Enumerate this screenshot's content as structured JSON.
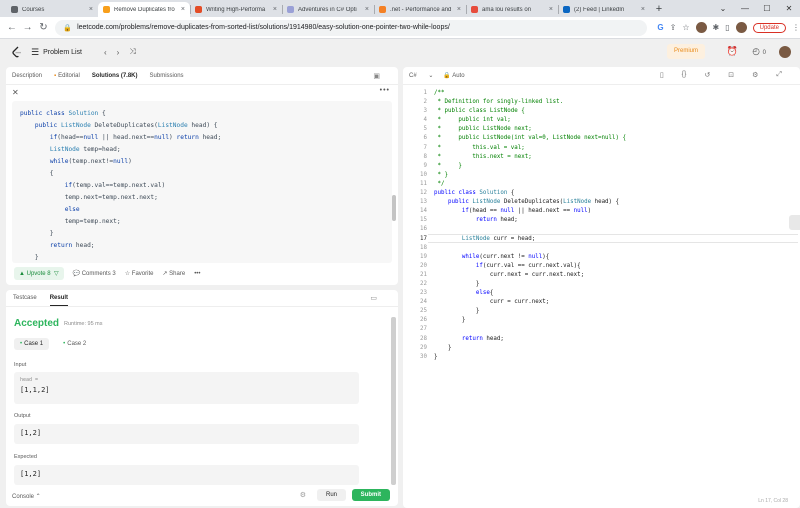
{
  "browser": {
    "tabs": [
      {
        "title": "Courses",
        "color": "#5f6368",
        "active": false
      },
      {
        "title": "Remove Duplicates fro",
        "color": "#f89f1b",
        "active": true
      },
      {
        "title": "Writing High-Performa",
        "color": "#e34c26",
        "active": false
      },
      {
        "title": "Adventures in C# Opti",
        "color": "#9aa0d6",
        "active": false
      },
      {
        "title": ".net - Performance and",
        "color": "#f48024",
        "active": false
      },
      {
        "title": "ama lou results on",
        "color": "#e74c3c",
        "active": false
      },
      {
        "title": "(2) Feed | LinkedIn",
        "color": "#0a66c2",
        "active": false
      }
    ],
    "url": "leetcode.com/problems/remove-duplicates-from-sorted-list/solutions/1914980/easy-solution-one-pointer-two-while-loops/",
    "update_label": "Update"
  },
  "header": {
    "problem_list": "Problem List",
    "premium": "Premium",
    "coins": "0"
  },
  "left_top": {
    "tabs": [
      "Description",
      "Editorial",
      "Solutions (7.8K)",
      "Submissions"
    ],
    "code_lines": [
      "public class Solution {",
      "    public ListNode DeleteDuplicates(ListNode head) {",
      "        if(head==null || head.next==null) return head;",
      "        ListNode temp=head;",
      "        while(temp.next!=null)",
      "        {",
      "            if(temp.val==temp.next.val)",
      "            temp.next=temp.next.next;",
      "            else",
      "            temp=temp.next;",
      "        }",
      "        return head;",
      "    }"
    ],
    "upvote": "Upvote 8",
    "comments": "Comments 3",
    "favorite": "Favorite",
    "share": "Share"
  },
  "left_bottom": {
    "tabs": [
      "Testcase",
      "Result"
    ],
    "status": "Accepted",
    "runtime": "Runtime: 95 ms",
    "case1": "Case 1",
    "case2": "Case 2",
    "input_label": "Input",
    "input_var": "head =",
    "input_value": "[1,1,2]",
    "output_label": "Output",
    "output_value": "[1,2]",
    "expected_label": "Expected",
    "expected_value": "[1,2]",
    "console": "Console",
    "run": "Run",
    "submit": "Submit"
  },
  "editor": {
    "language": "C#",
    "mode": "Auto",
    "status": "Ln 17, Col 28",
    "lines": [
      "/**",
      " * Definition for singly-linked list.",
      " * public class ListNode {",
      " *     public int val;",
      " *     public ListNode next;",
      " *     public ListNode(int val=0, ListNode next=null) {",
      " *         this.val = val;",
      " *         this.next = next;",
      " *     }",
      " * }",
      " */",
      "public class Solution {",
      "    public ListNode DeleteDuplicates(ListNode head) {",
      "        if(head == null || head.next == null)",
      "            return head;",
      "",
      "        ListNode curr = head;",
      "",
      "        while(curr.next != null){",
      "            if(curr.val == curr.next.val){",
      "                curr.next = curr.next.next;",
      "            }",
      "            else{",
      "                curr = curr.next;",
      "            }",
      "        }",
      "",
      "        return head;",
      "    }",
      "}"
    ],
    "current_line": 17
  }
}
